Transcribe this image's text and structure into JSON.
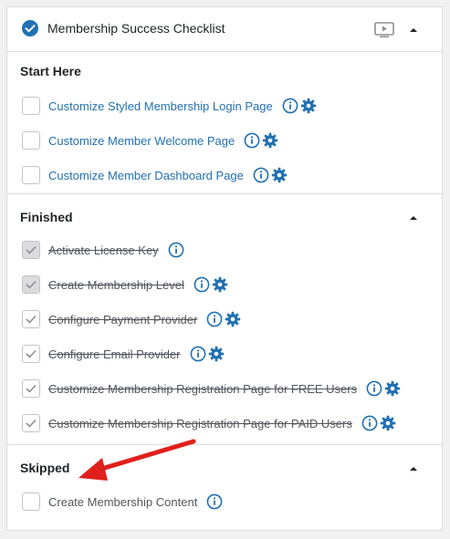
{
  "panel": {
    "title": "Membership Success Checklist",
    "icons": {
      "status": "check-circle-icon",
      "video": "video-icon",
      "collapse": "caret-up-icon"
    }
  },
  "sections": {
    "start": {
      "title": "Start Here",
      "items": [
        {
          "label": "Customize Styled Membership Login Page",
          "checked": false,
          "has_gear": true
        },
        {
          "label": "Customize Member Welcome Page",
          "checked": false,
          "has_gear": true
        },
        {
          "label": "Customize Member Dashboard Page",
          "checked": false,
          "has_gear": true
        }
      ]
    },
    "finished": {
      "title": "Finished",
      "items": [
        {
          "label": "Activate License Key",
          "checked": true,
          "has_gear": false
        },
        {
          "label": "Create Membership Level",
          "checked": true,
          "has_gear": true
        },
        {
          "label": "Configure Payment Provider",
          "checked": true,
          "has_gear": true
        },
        {
          "label": "Configure Email Provider",
          "checked": true,
          "has_gear": true
        },
        {
          "label": "Customize Membership Registration Page for FREE Users",
          "checked": true,
          "has_gear": true
        },
        {
          "label": "Customize Membership Registration Page for PAID Users",
          "checked": true,
          "has_gear": true
        }
      ]
    },
    "skipped": {
      "title": "Skipped",
      "items": [
        {
          "label": "Create Membership Content",
          "checked": false,
          "has_gear": false
        }
      ]
    }
  },
  "colors": {
    "accent": "#2271b1",
    "arrow": "#e0201b",
    "muted": "#50575e"
  }
}
